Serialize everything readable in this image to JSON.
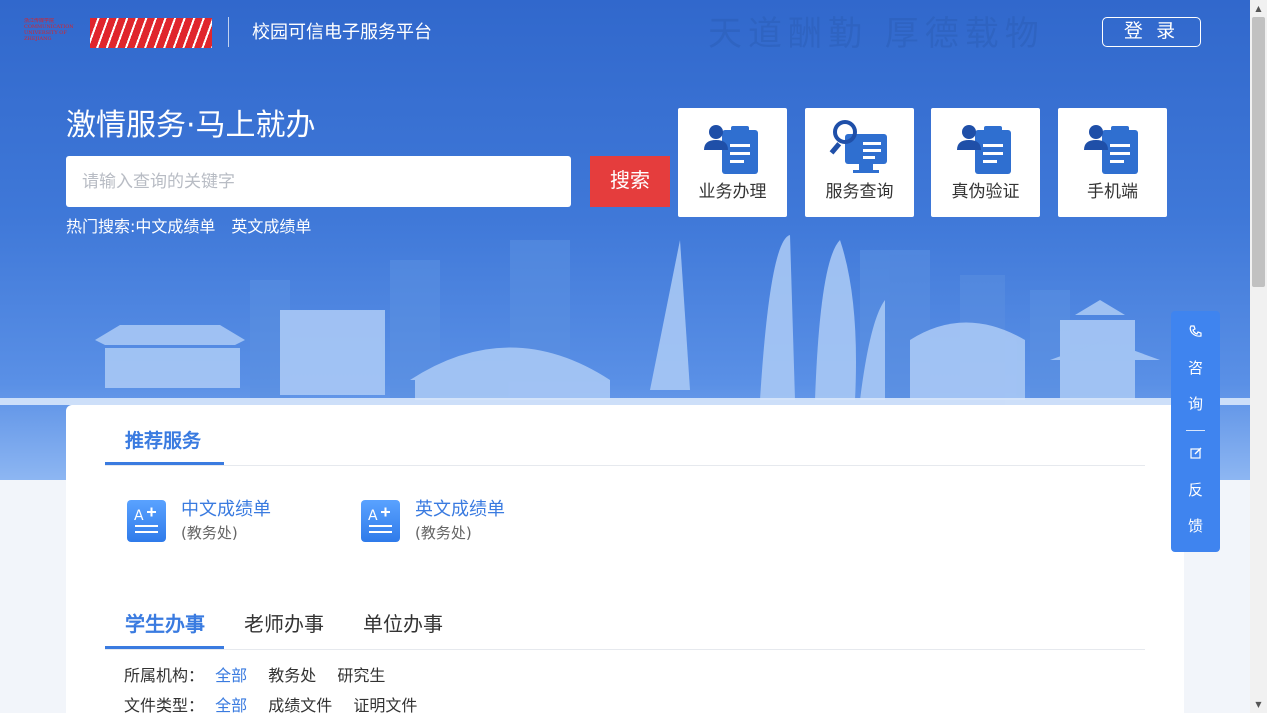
{
  "header": {
    "logo_text": "浙江传媒学院 COMMUNICATION UNIVERSITY OF ZHEJIANG",
    "site_title": "校园可信电子服务平台",
    "motto": "天道酬勤 厚德载物",
    "login_label": "登 录"
  },
  "search": {
    "slogan": "激情服务·马上就办",
    "placeholder": "请输入查询的关键字",
    "button_label": "搜索",
    "hot_label": "热门搜索:",
    "hot_items": [
      "中文成绩单",
      "英文成绩单"
    ]
  },
  "tiles": [
    {
      "label": "业务办理",
      "icon": "clipboard-user-icon"
    },
    {
      "label": "服务查询",
      "icon": "search-monitor-icon"
    },
    {
      "label": "真伪验证",
      "icon": "clipboard-user-icon"
    },
    {
      "label": "手机端",
      "icon": "clipboard-user-icon"
    }
  ],
  "consult": {
    "consult_chars": [
      "咨",
      "询"
    ],
    "feedback_chars": [
      "反",
      "馈"
    ]
  },
  "recommended": {
    "title": "推荐服务",
    "items": [
      {
        "name": "中文成绩单",
        "dept": "(教务处)",
        "icon": "transcript-icon"
      },
      {
        "name": "英文成绩单",
        "dept": "(教务处)",
        "icon": "transcript-icon"
      }
    ]
  },
  "tabs": {
    "items": [
      "学生办事",
      "老师办事",
      "单位办事"
    ],
    "active_index": 0
  },
  "filters": [
    {
      "label": "所属机构：",
      "options": [
        "全部",
        "教务处",
        "研究生"
      ],
      "selected": "全部"
    },
    {
      "label": "文件类型：",
      "options": [
        "全部",
        "成绩文件",
        "证明文件"
      ],
      "selected": "全部"
    }
  ],
  "colors": {
    "primary": "#3a7be0",
    "search_button": "#e53d3d",
    "hero_top": "#3168cc",
    "consult_panel": "#3f84ef"
  }
}
